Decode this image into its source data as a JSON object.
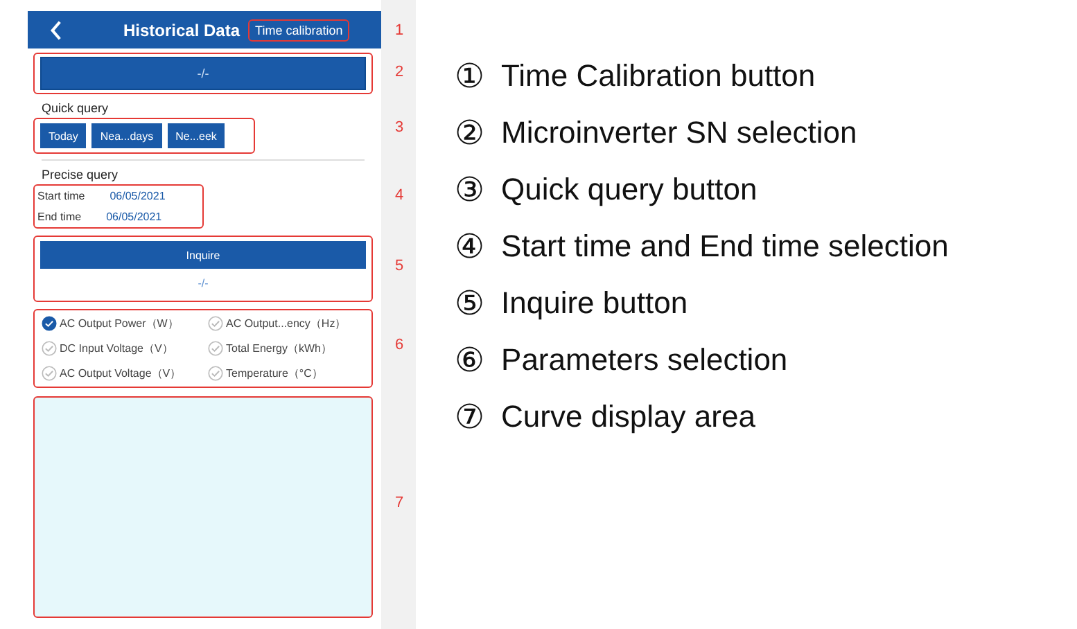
{
  "header": {
    "title": "Historical Data",
    "action": "Time calibration",
    "callout": "1"
  },
  "sn_selector": {
    "value": "-/-",
    "callout": "2"
  },
  "quick_query": {
    "label": "Quick query",
    "buttons": [
      "Today",
      "Nea...days",
      "Ne...eek"
    ],
    "callout": "3"
  },
  "precise_query": {
    "label": "Precise query",
    "fields": [
      {
        "label": "Start time",
        "value": "06/05/2021"
      },
      {
        "label": "End time",
        "value": "06/05/2021"
      }
    ],
    "callout": "4"
  },
  "inquire": {
    "button": "Inquire",
    "result": "-/-",
    "callout": "5"
  },
  "parameters": {
    "callout": "6",
    "items": [
      {
        "label": "AC Output Power（W）",
        "checked": true
      },
      {
        "label": "AC Output...ency（Hz）",
        "checked": false
      },
      {
        "label": "DC Input Voltage（V）",
        "checked": false
      },
      {
        "label": "Total Energy（kWh）",
        "checked": false
      },
      {
        "label": "AC Output Voltage（V）",
        "checked": false
      },
      {
        "label": "Temperature（°C）",
        "checked": false
      }
    ]
  },
  "curve_area": {
    "callout": "7"
  },
  "legend": [
    {
      "number": "①",
      "text": "Time Calibration button"
    },
    {
      "number": "②",
      "text": "Microinverter SN selection"
    },
    {
      "number": "③",
      "text": "Quick query button"
    },
    {
      "number": "④",
      "text": "Start time and End time selection"
    },
    {
      "number": "⑤",
      "text": "Inquire button"
    },
    {
      "number": "⑥",
      "text": "Parameters selection"
    },
    {
      "number": "⑦",
      "text": "Curve display area"
    }
  ]
}
